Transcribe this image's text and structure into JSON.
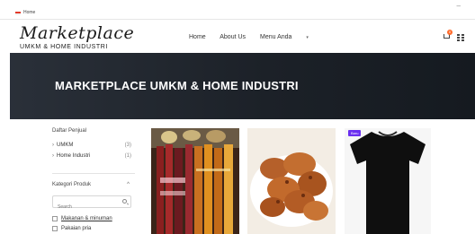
{
  "topbar": {
    "language": "Home"
  },
  "header": {
    "logo_script": "Marketplace",
    "logo_sub": "UMKM & HOME INDUSTRI",
    "nav": [
      "Home",
      "About Us",
      "Menu Anda"
    ],
    "cart_count": "0"
  },
  "banner": {
    "title": "MARKETPLACE UMKM & HOME INDUSTRI"
  },
  "sidebar": {
    "sellers_heading": "Daftar Penjual",
    "sellers": [
      {
        "label": "UMKM",
        "count": "(3)"
      },
      {
        "label": "Home Industri",
        "count": "(1)"
      }
    ],
    "category_heading": "Kategori Produk",
    "category_toggle": "^",
    "search_placeholder": "Search",
    "categories": [
      "Makanan & minuman",
      "Pakaian pria"
    ]
  },
  "products": [
    {
      "image": "bottled-drinks",
      "tag": ""
    },
    {
      "image": "fried-snacks",
      "tag": ""
    },
    {
      "image": "black-tshirt",
      "tag": "Baru"
    }
  ],
  "colors": {
    "banner": "#1c2128",
    "badge": "#ff6a2a",
    "tag": "#6a2ff0"
  }
}
